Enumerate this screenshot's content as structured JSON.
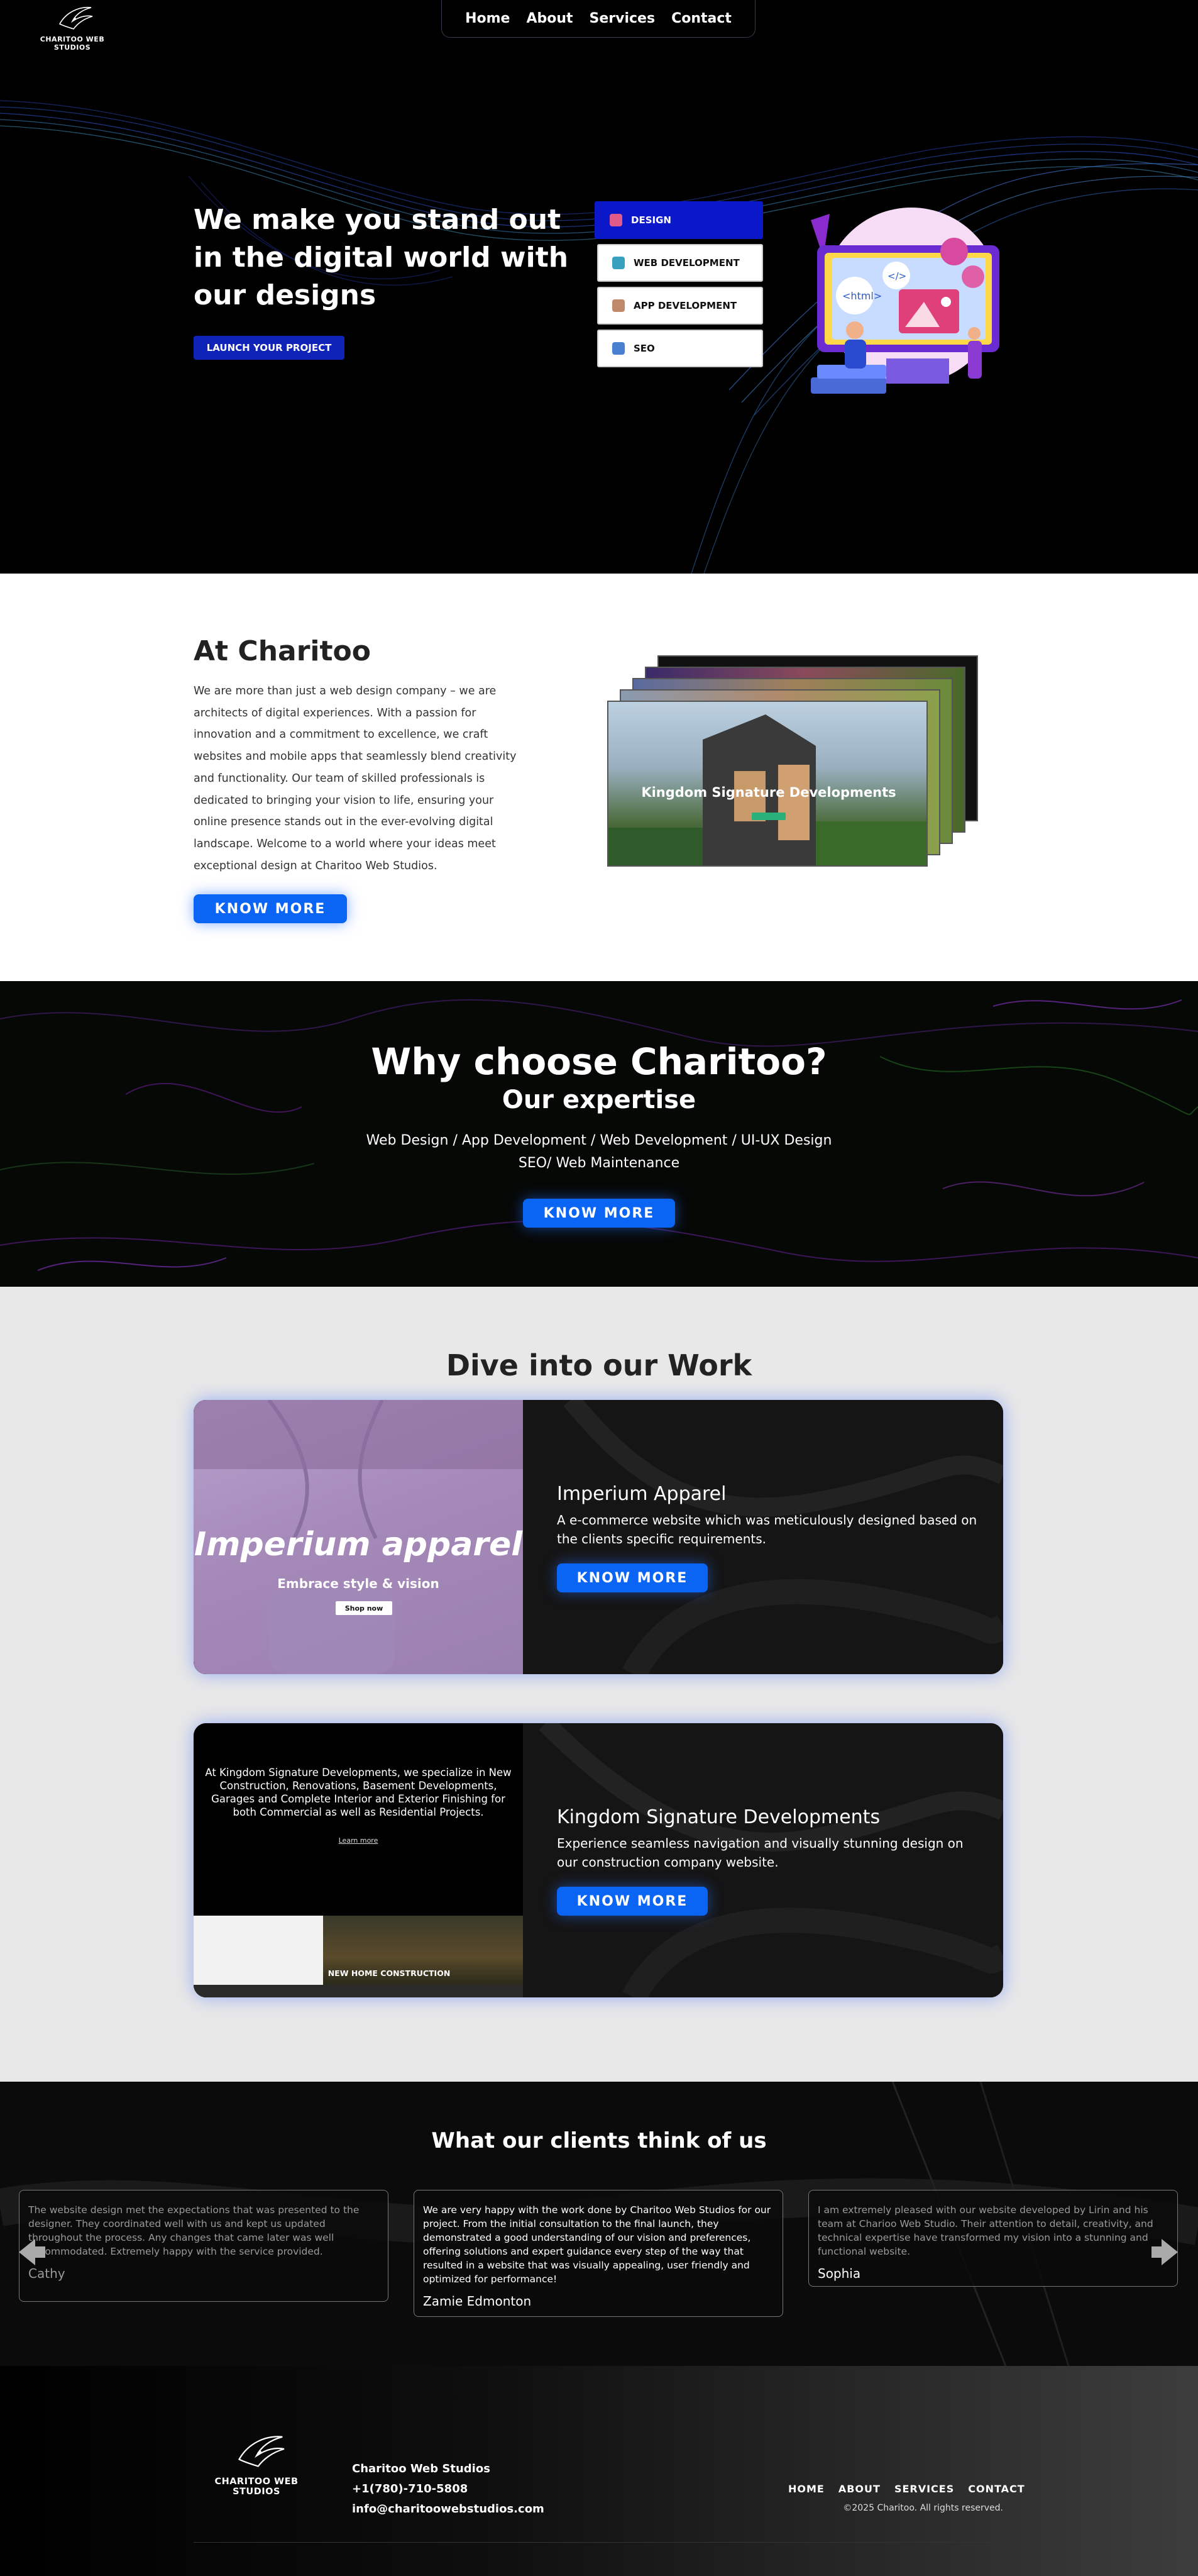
{
  "header": {
    "logo_text": "CHARITOO WEB STUDIOS",
    "nav": [
      "Home",
      "About",
      "Services",
      "Contact"
    ]
  },
  "hero": {
    "title": "We make you stand out in the digital world with our designs",
    "cta": "LAUNCH YOUR PROJECT",
    "services": [
      {
        "label": "DESIGN",
        "icon": "design-icon",
        "active": true
      },
      {
        "label": "WEB DEVELOPMENT",
        "icon": "web-dev-icon",
        "active": false
      },
      {
        "label": "APP DEVELOPMENT",
        "icon": "app-dev-icon",
        "active": false
      },
      {
        "label": "SEO",
        "icon": "seo-icon",
        "active": false
      }
    ],
    "illustration_tags": [
      "<html>",
      "</>"
    ]
  },
  "about": {
    "title": "At Charitoo",
    "text": "We are more than just a web design company – we are architects of digital experiences. With a passion for innovation and a commitment to excellence, we craft websites and mobile apps that seamlessly blend creativity and functionality. Our team of skilled professionals is dedicated to bringing your vision to life, ensuring your online presence stands out in the ever-evolving digital landscape. Welcome to a world where your ideas meet exceptional design at Charitoo Web Studios.",
    "cta": "KNOW MORE",
    "mockup_heading": "Kingdom Signature Developments"
  },
  "why": {
    "title": "Why choose Charitoo?",
    "subtitle": "Our expertise",
    "line1": "Web Design / App Development / Web Development / UI-UX Design",
    "line2": "SEO/ Web Maintenance",
    "cta": "KNOW MORE"
  },
  "work": {
    "title": "Dive into our Work",
    "projects": [
      {
        "title": "Imperium Apparel",
        "desc": "A e-commerce website which was meticulously designed based on the clients specific requirements.",
        "cta": "KNOW MORE",
        "img_title": "Imperium apparel",
        "img_sub": "Embrace style & vision",
        "img_btn": "Shop now"
      },
      {
        "title": "Kingdom Signature Developments",
        "desc": "Experience seamless navigation and visually stunning design on our construction company website.",
        "cta": "KNOW MORE",
        "img_text": "At Kingdom Signature Developments, we specialize in New Construction, Renovations, Basement Developments, Garages and Complete Interior and Exterior Finishing for both Commercial as well as Residential Projects.",
        "img_link": "Learn more",
        "img_banner": "NEW HOME CONSTRUCTION"
      }
    ]
  },
  "testimonials": {
    "title": "What our clients think of us",
    "items": [
      {
        "text": "The website design met the expectations that was presented to the designer. They coordinated well with us and kept us updated throughout the process. Any changes that came later was well accommodated. Extremely happy with the service provided.",
        "name": "Cathy"
      },
      {
        "text": "We are very happy with the work done by Charitoo Web Studios for our project. From the initial consultation to the final launch, they demonstrated a good understanding of our vision and preferences, offering solutions and expert guidance every step of the way that resulted in a website that was visually appealing, user friendly and optimized for performance!",
        "name": "Zamie Edmonton"
      },
      {
        "text": "I am extremely pleased with our website developed by Lirin and his team at Charioo Web Studio. Their attention to detail, creativity, and technical expertise have transformed my vision into a stunning and functional website.",
        "name": "Sophia"
      }
    ]
  },
  "footer": {
    "logo_text": "CHARITOO WEB STUDIOS",
    "company": "Charitoo Web Studios",
    "phone": "+1(780)-710-5808",
    "email": "info@charitoowebstudios.com",
    "nav": [
      "HOME",
      "ABOUT",
      "SERVICES",
      "CONTACT"
    ],
    "copyright": "©2025 Charitoo. All rights reserved."
  },
  "colors": {
    "accent_blue": "#0a64f4",
    "hero_button": "#1023b8",
    "active_service": "#0b18c9"
  }
}
